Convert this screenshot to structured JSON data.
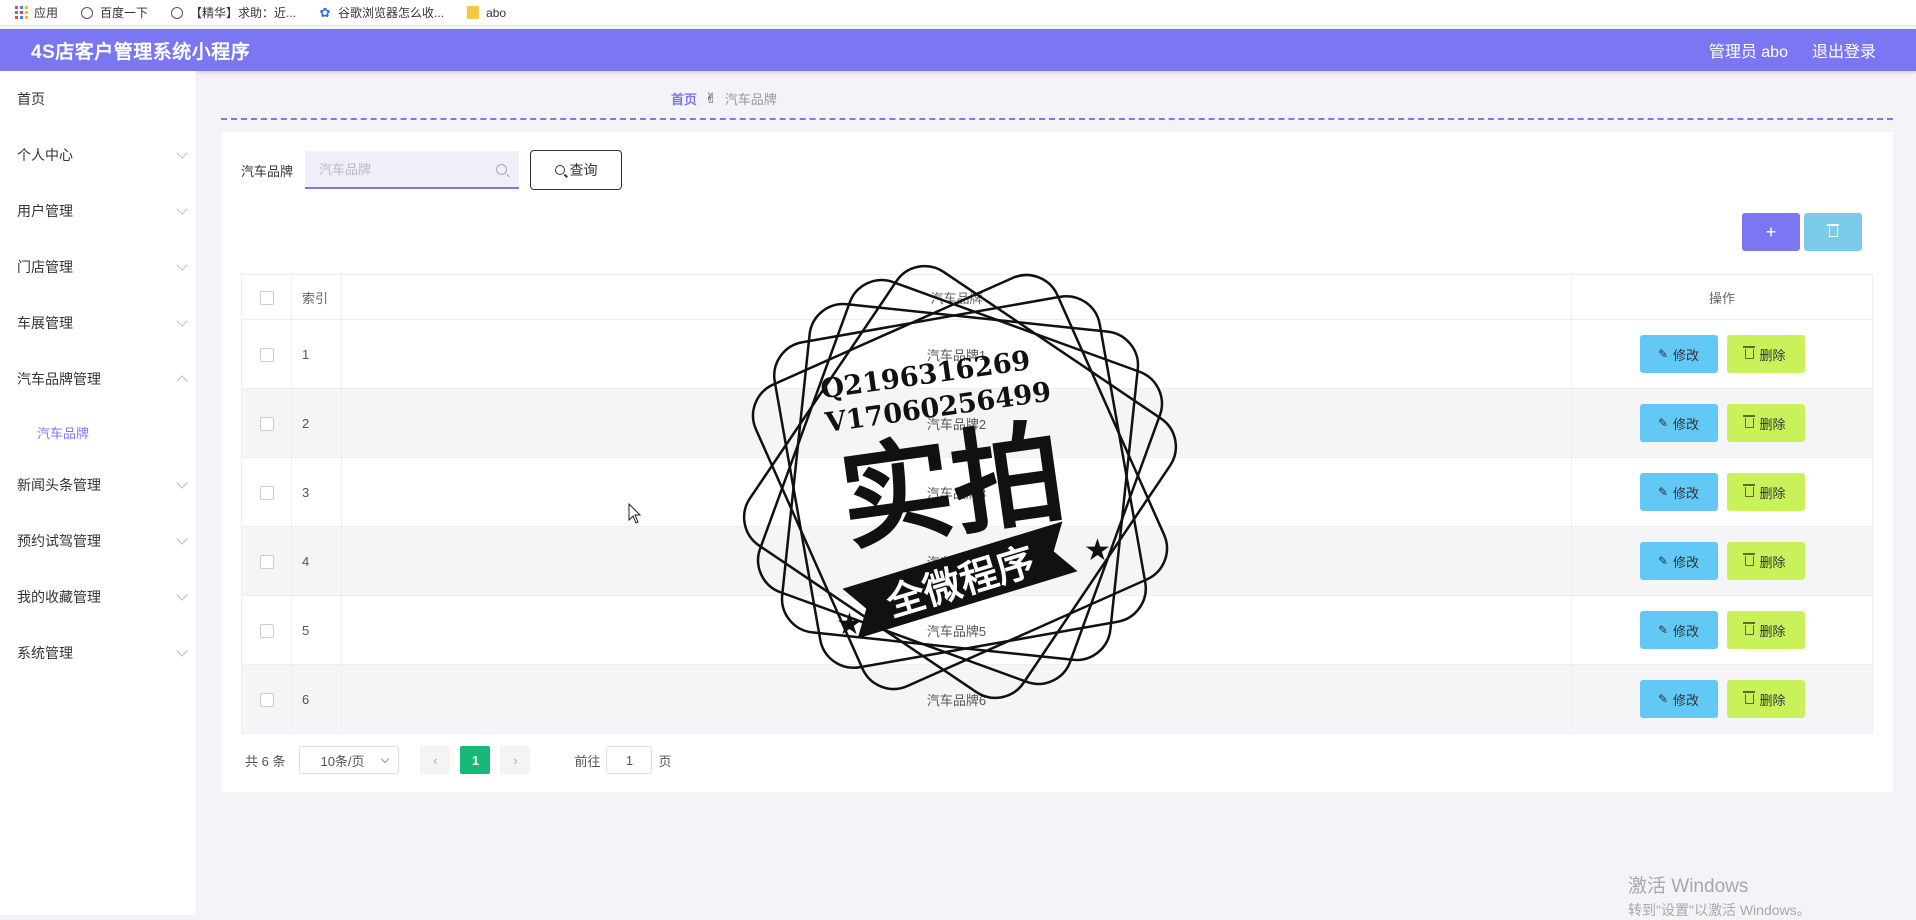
{
  "bookmarks": [
    {
      "label": "应用",
      "icon": "apps-grid-icon"
    },
    {
      "label": "百度一下",
      "icon": "globe-icon"
    },
    {
      "label": "【精华】求助：近...",
      "icon": "globe-icon"
    },
    {
      "label": "谷歌浏览器怎么收...",
      "icon": "paw-icon"
    },
    {
      "label": "abo",
      "icon": "folder-icon"
    }
  ],
  "header": {
    "title": "4S店客户管理系统小程序",
    "user": "管理员 abo",
    "logout": "退出登录",
    "color": "#7b77f2"
  },
  "sidebar": {
    "items": [
      {
        "label": "首页"
      },
      {
        "label": "个人中心"
      },
      {
        "label": "用户管理"
      },
      {
        "label": "门店管理"
      },
      {
        "label": "车展管理"
      },
      {
        "label": "汽车品牌管理"
      },
      {
        "label": "汽车品牌"
      },
      {
        "label": "新闻头条管理"
      },
      {
        "label": "预约试驾管理"
      },
      {
        "label": "我的收藏管理"
      },
      {
        "label": "系统管理"
      }
    ]
  },
  "breadcrumb": {
    "home": "首页",
    "current": "汽车品牌"
  },
  "search": {
    "label": "汽车品牌",
    "placeholder": "汽车品牌",
    "button": "查询"
  },
  "toolbar": {
    "add": "+"
  },
  "table": {
    "headers": {
      "index": "索引",
      "brand": "汽车品牌",
      "ops": "操作"
    },
    "edit_label": "修改",
    "delete_label": "删除",
    "rows": [
      {
        "index": "1",
        "brand": "汽车品牌1"
      },
      {
        "index": "2",
        "brand": "汽车品牌2"
      },
      {
        "index": "3",
        "brand": "汽车品牌3"
      },
      {
        "index": "4",
        "brand": "汽车品牌4"
      },
      {
        "index": "5",
        "brand": "汽车品牌5"
      },
      {
        "index": "6",
        "brand": "汽车品牌6"
      }
    ]
  },
  "pagination": {
    "total": "共 6 条",
    "page_size": "10条/页",
    "current_page": "1",
    "goto_prefix": "前往",
    "goto_value": "1",
    "goto_suffix": "页",
    "active_color": "#17b978"
  },
  "watermark": {
    "contact1": "Q2196316269",
    "contact2": "V17060256499",
    "main": "实拍",
    "banner": "全微程序"
  },
  "windows": {
    "title": "激活 Windows",
    "subtitle": "转到\"设置\"以激活 Windows。"
  }
}
